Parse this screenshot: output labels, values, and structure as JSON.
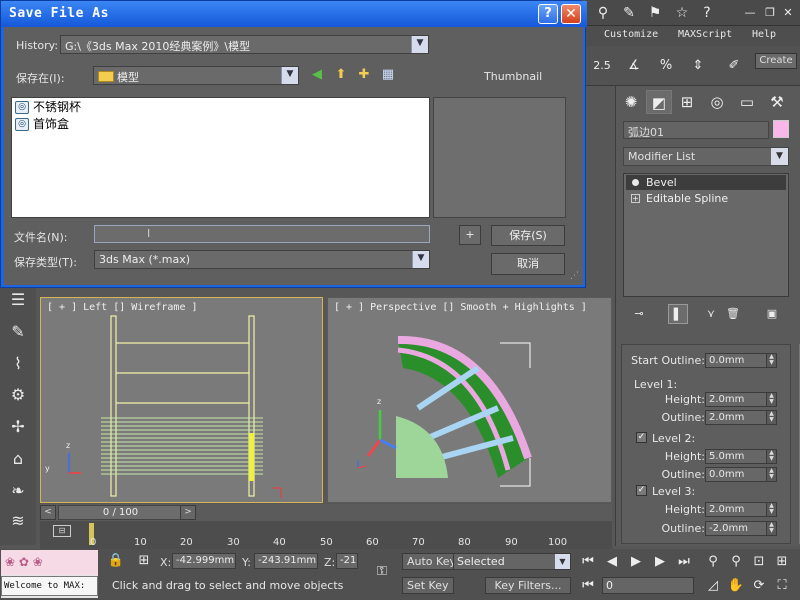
{
  "dialog": {
    "title": "Save File As",
    "help_label": "?",
    "close_label": "✕",
    "history_label": "History:",
    "history_value": "G:\\《3ds Max 2010经典案例》\\模型",
    "save_in_label": "保存在(I):",
    "save_in_value": "模型",
    "thumbnail_label": "Thumbnail",
    "files": [
      "不锈钢杯",
      "首饰盒"
    ],
    "filename_label": "文件名(N):",
    "filename_value": "",
    "filetype_label": "保存类型(T):",
    "filetype_value": "3ds Max (*.max)",
    "plus_label": "+",
    "save_button": "保存(S)",
    "cancel_button": "取消"
  },
  "menubar": {
    "items": [
      "Customize",
      "MAXScript",
      "Help"
    ]
  },
  "toolbar": {
    "snap_value": "2.5",
    "create_label": "Create"
  },
  "command_panel": {
    "object_name": "弧边01",
    "object_color": "#f8b7e8",
    "modifier_list_label": "Modifier List",
    "stack_items": [
      "Bevel",
      "Editable Spline"
    ],
    "start_outline_label": "Start Outline:",
    "start_outline_value": "0.0mm",
    "level1_label": "Level 1:",
    "level1_height_label": "Height:",
    "level1_height_value": "2.0mm",
    "level1_outline_label": "Outline:",
    "level1_outline_value": "2.0mm",
    "level2_label": "Level 2:",
    "level2_height_label": "Height:",
    "level2_height_value": "5.0mm",
    "level2_outline_label": "Outline:",
    "level2_outline_value": "0.0mm",
    "level3_label": "Level 3:",
    "level3_height_label": "Height:",
    "level3_height_value": "2.0mm",
    "level3_outline_label": "Outline:",
    "level3_outline_value": "-2.0mm"
  },
  "viewports": {
    "left_label": "[ + ] Left [] Wireframe ]",
    "persp_label": "[ + ] Perspective [] Smooth + Highlights ]"
  },
  "timeline": {
    "frame_display": "0 / 100",
    "ticks": [
      "0",
      "10",
      "20",
      "30",
      "40",
      "50",
      "60",
      "70",
      "80",
      "90",
      "100"
    ]
  },
  "statusbar": {
    "welcome_text": "Welcome to MAX:",
    "x_label": "X:",
    "x_value": "-42.999mm",
    "y_label": "Y:",
    "y_value": "-243.91mm",
    "z_label": "Z:",
    "z_value": "-21",
    "auto_key_label": "Auto Key",
    "selected_label": "Selected",
    "set_key_label": "Set Key",
    "key_filters_label": "Key Filters...",
    "frame_value": "0",
    "prompt_text": "Click and drag to select and move objects"
  }
}
